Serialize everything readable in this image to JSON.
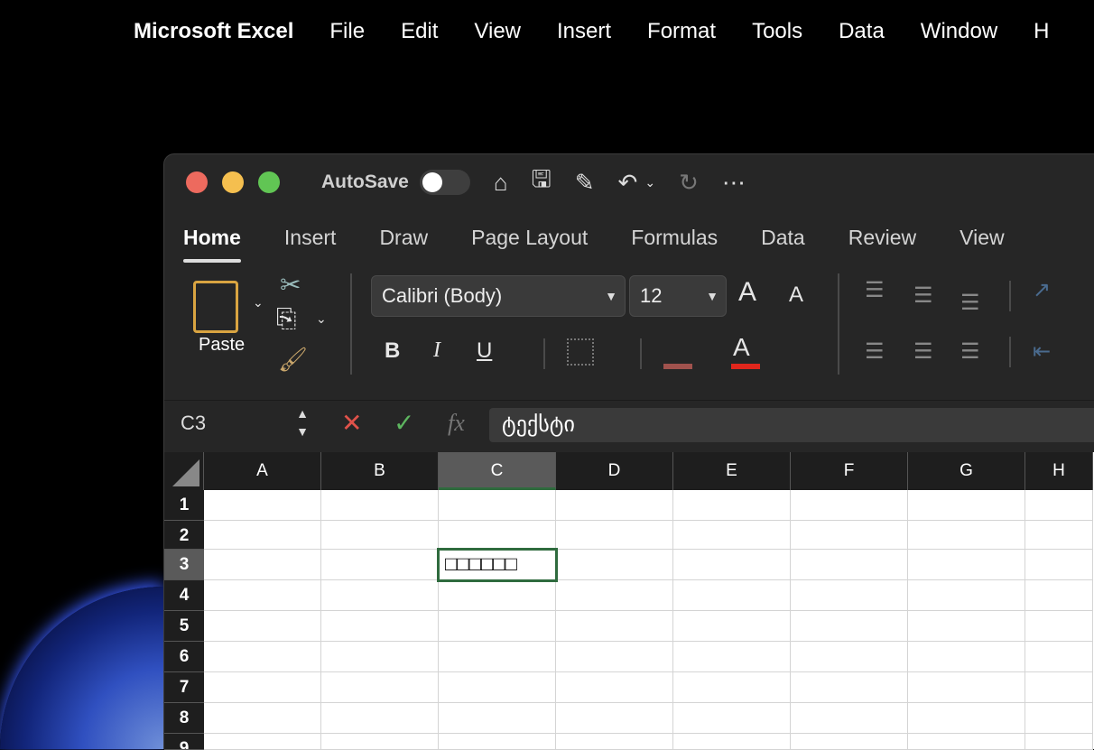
{
  "menubar": {
    "app": "Microsoft Excel",
    "items": [
      "File",
      "Edit",
      "View",
      "Insert",
      "Format",
      "Tools",
      "Data",
      "Window",
      "H"
    ]
  },
  "titlebar": {
    "autosave": "AutoSave"
  },
  "tabs": [
    "Home",
    "Insert",
    "Draw",
    "Page Layout",
    "Formulas",
    "Data",
    "Review",
    "View"
  ],
  "ribbon": {
    "paste": "Paste",
    "font": "Calibri (Body)",
    "size": "12",
    "bold": "B",
    "italic": "I",
    "underline": "U",
    "grow": "A",
    "shrink": "A",
    "fontcolor": "A"
  },
  "formula_bar": {
    "name_box": "C3",
    "fx": "fx",
    "value": "ტექსტი"
  },
  "sheet": {
    "columns": [
      "A",
      "B",
      "C",
      "D",
      "E",
      "F",
      "G",
      "H"
    ],
    "rows": [
      "1",
      "2",
      "3",
      "4",
      "5",
      "6",
      "7",
      "8",
      "9"
    ],
    "active_cell": "C3",
    "active_cell_display": "□□□□□□"
  }
}
